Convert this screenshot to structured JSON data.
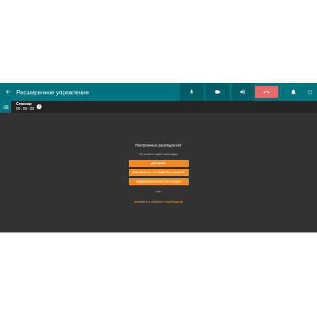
{
  "header": {
    "title": "Расширенное управление",
    "back_icon": "arrow-left-icon"
  },
  "toolbar": {
    "mic_icon": "microphone-icon",
    "camera_icon": "video-camera-icon",
    "speaker_icon": "speaker-icon",
    "hangup_icon": "phone-hangup-icon",
    "bell_icon": "bell-icon",
    "fullscreen_icon": "fullscreen-icon",
    "hangup_color": "#e46b6b"
  },
  "subbar": {
    "seminar_name": "Семинар",
    "timer": "00 : 00 : 28",
    "info_glyph": "i"
  },
  "main": {
    "no_layouts": "Настроенных раскладок нет",
    "can_create": "Вы можете задать раскладку",
    "buttons": [
      "ДЛЯ ВСЕХ",
      "ДЛЯ SIP/H.323 УСТРОЙСТВ И WEBRTC",
      "ИНДИВИДУАЛЬНАЯ РАСКЛАДКА"
    ],
    "or": "или",
    "participants_link": "ПЕРЕЙТИ К СПИСКУ УЧАСТНИКОВ"
  },
  "colors": {
    "accent": "#00747f",
    "accent_dark": "#005e68",
    "button_orange": "#f28a1e",
    "background": "#333333"
  }
}
